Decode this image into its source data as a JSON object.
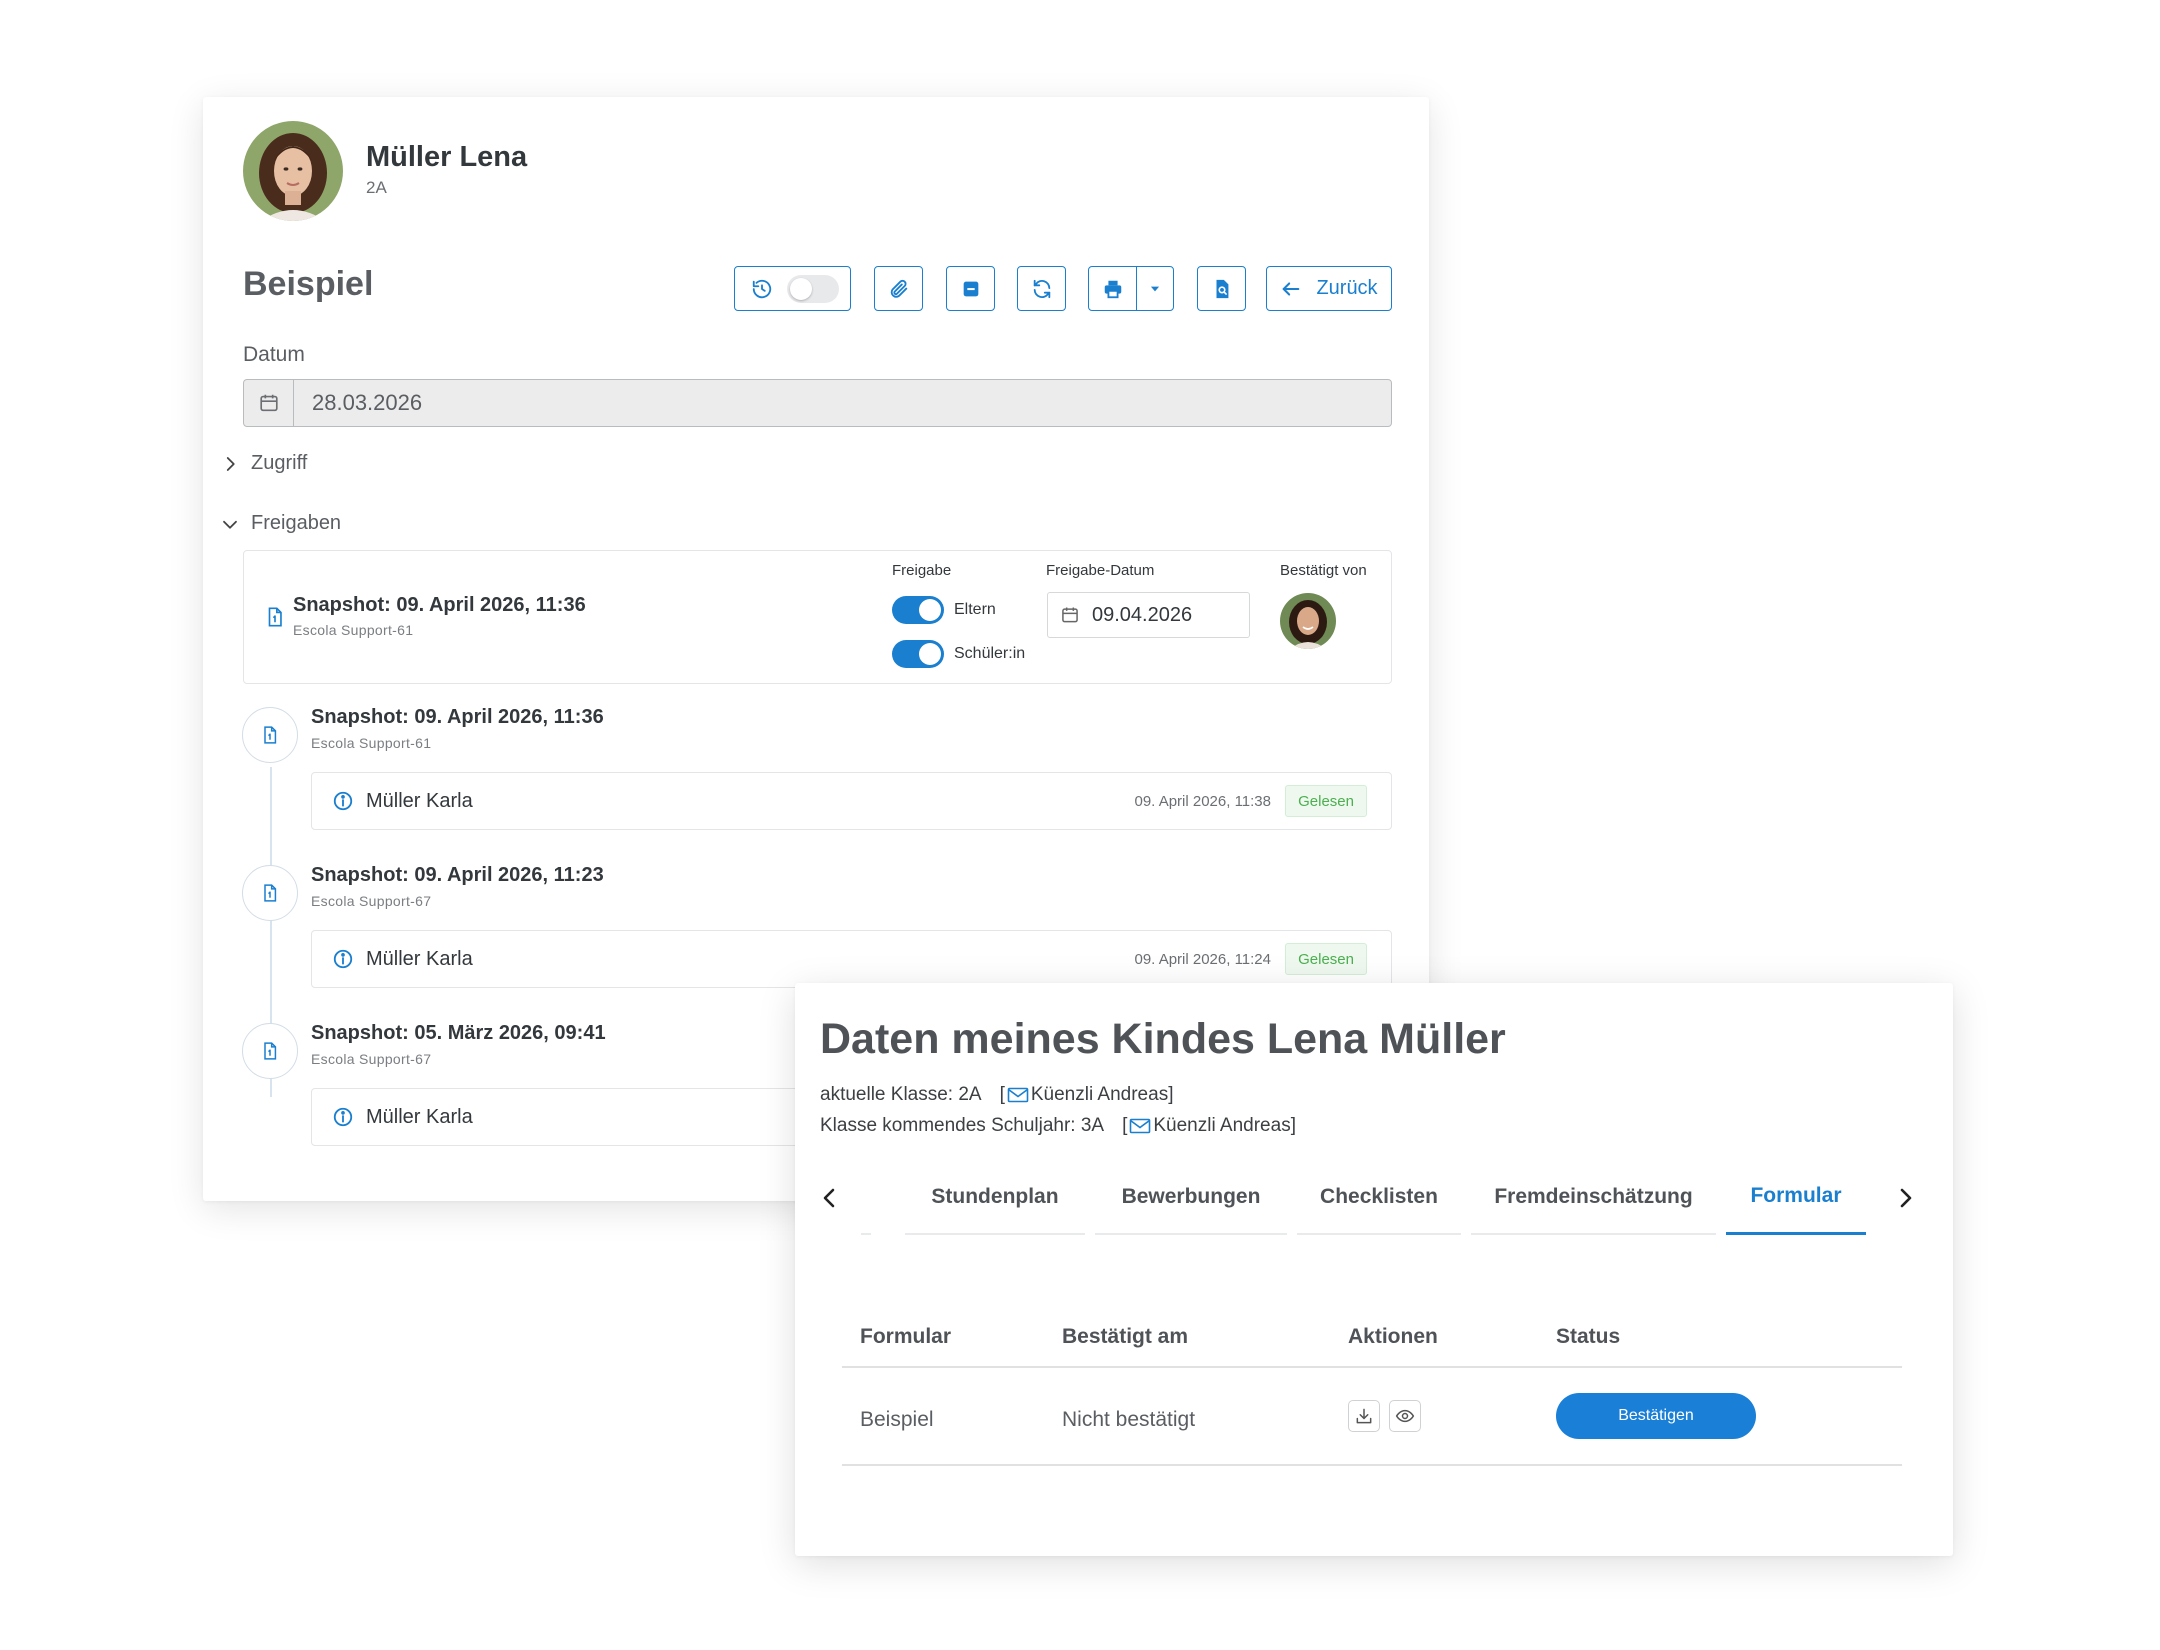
{
  "student": {
    "name": "Müller Lena",
    "class": "2A"
  },
  "page": {
    "title": "Beispiel"
  },
  "toolbar": {
    "back_label": "Zurück"
  },
  "date_field": {
    "label": "Datum",
    "value": "28.03.2026"
  },
  "sections": {
    "access": "Zugriff",
    "releases": "Freigaben"
  },
  "release": {
    "snapshot_title": "Snapshot: 09. April 2026, 11:36",
    "snapshot_user": "Escola Support-61",
    "col_release": "Freigabe",
    "col_date": "Freigabe-Datum",
    "col_confirmed_by": "Bestätigt von",
    "toggle_parents": "Eltern",
    "toggle_student": "Schüler:in",
    "release_date": "09.04.2026"
  },
  "timeline": [
    {
      "title": "Snapshot: 09. April 2026, 11:36",
      "user": "Escola Support-61",
      "reader": "Müller Karla",
      "read_time": "09. April 2026, 11:38",
      "badge": "Gelesen"
    },
    {
      "title": "Snapshot: 09. April 2026, 11:23",
      "user": "Escola Support-67",
      "reader": "Müller Karla",
      "read_time": "09. April 2026, 11:24",
      "badge": "Gelesen"
    },
    {
      "title": "Snapshot: 05. März 2026, 09:41",
      "user": "Escola Support-67",
      "reader": "Müller Karla"
    }
  ],
  "parent_view": {
    "title": "Daten meines Kindes Lena Müller",
    "current_class": "aktuelle Klasse: 2A",
    "next_class": "Klasse kommendes Schuljahr: 3A",
    "teacher_current": "Küenzli Andreas]",
    "teacher_next": "Küenzli Andreas]",
    "bracket_open": "[",
    "tabs": [
      "Stundenplan",
      "Bewerbungen",
      "Checklisten",
      "Fremdeinschätzung",
      "Formular"
    ],
    "active_tab": "Formular",
    "table": {
      "headers": [
        "Formular",
        "Bestätigt am",
        "Aktionen",
        "Status"
      ],
      "rows": [
        {
          "form": "Beispiel",
          "confirmed": "Nicht bestätigt",
          "status_button": "Bestätigen"
        }
      ]
    }
  },
  "colors": {
    "accent": "#1a7fcf",
    "success": "#4caf50",
    "button": "#1a7fd7"
  },
  "icons": [
    "history-icon",
    "paperclip-icon",
    "minus-square-icon",
    "refresh-icon",
    "printer-icon",
    "caret-down-icon",
    "file-search-icon",
    "arrow-left-icon",
    "calendar-icon",
    "chevron-right-icon",
    "chevron-down-icon",
    "document-icon",
    "info-icon",
    "mail-icon",
    "chevron-left-icon",
    "download-icon",
    "eye-icon"
  ]
}
